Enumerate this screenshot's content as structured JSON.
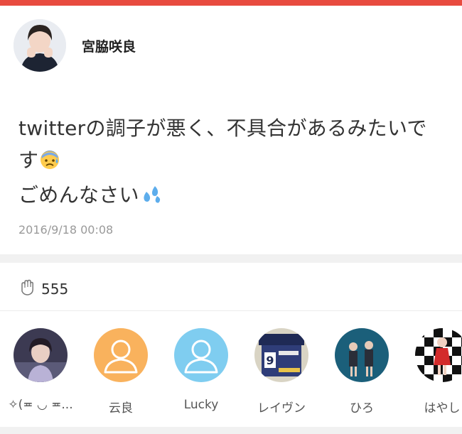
{
  "post": {
    "author_name": "宮脇咲良",
    "text_line1": "twitterの調子が悪く、不具合があるみたいで",
    "text_line2": "す",
    "text_line3": "ごめんなさい",
    "emoji_1": "anxious-sweat-face",
    "emoji_2": "sweat-droplets",
    "timestamp": "2016/9/18 00:08"
  },
  "likes": {
    "count": "555",
    "icon": "clapping-hand-icon"
  },
  "likers": [
    {
      "name": "✧(≖ ◡ ≖...",
      "avatar": "photo"
    },
    {
      "name": "云良",
      "avatar": "default-orange"
    },
    {
      "name": "Lucky",
      "avatar": "default-blue"
    },
    {
      "name": "レイヴン",
      "avatar": "photo"
    },
    {
      "name": "ひろ",
      "avatar": "photo"
    },
    {
      "name": "はやし",
      "avatar": "photo"
    }
  ],
  "colors": {
    "accent": "#e84b3f",
    "default_orange": "#f9b25d",
    "default_blue": "#7fcdf0"
  }
}
